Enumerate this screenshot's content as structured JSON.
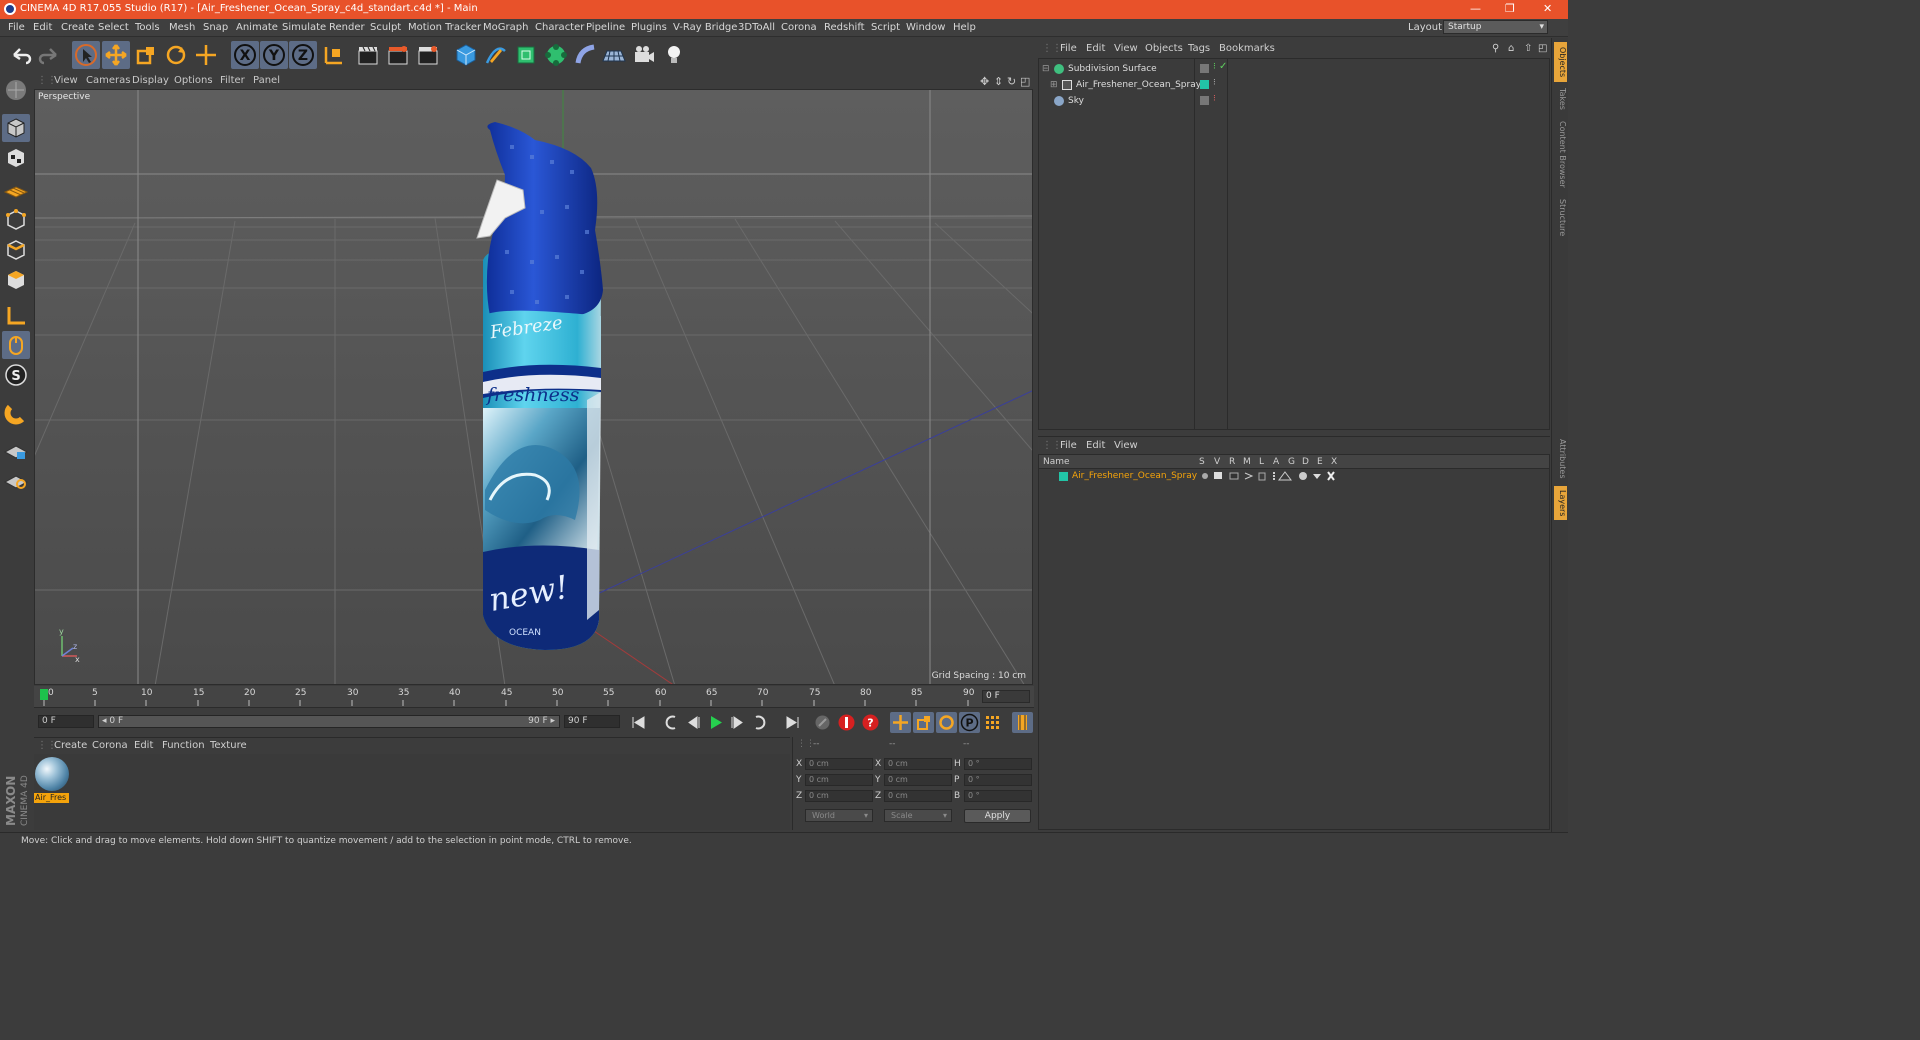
{
  "window": {
    "title": "CINEMA 4D R17.055 Studio (R17) - [Air_Freshener_Ocean_Spray_c4d_standart.c4d *] - Main",
    "minimize": "—",
    "restore": "❐",
    "close": "✕"
  },
  "menu": {
    "items": [
      "File",
      "Edit",
      "Create",
      "Select",
      "Tools",
      "Mesh",
      "Snap",
      "Animate",
      "Simulate",
      "Render",
      "Sculpt",
      "Motion Tracker",
      "MoGraph",
      "Character",
      "Pipeline",
      "Plugins",
      "V-Ray Bridge",
      "3DToAll",
      "Corona",
      "Redshift",
      "Script",
      "Window",
      "Help"
    ],
    "layout_label": "Layout:",
    "layout_value": "Startup"
  },
  "viewport": {
    "menu": [
      "View",
      "Cameras",
      "Display",
      "Options",
      "Filter",
      "Panel"
    ],
    "label": "Perspective",
    "grid_spacing": "Grid Spacing : 10 cm",
    "bottle_text": {
      "brand": "Febreze",
      "freshness": "freshness",
      "new": "new!",
      "ocean": "OCEAN"
    }
  },
  "timeline": {
    "ticks": [
      "0",
      "5",
      "10",
      "15",
      "20",
      "25",
      "30",
      "35",
      "40",
      "45",
      "50",
      "55",
      "60",
      "65",
      "70",
      "75",
      "80",
      "85",
      "90"
    ],
    "current_frame_field": "0 F",
    "start_field": "0 F",
    "range_start": "◂ 0 F",
    "range_end": "90 F ▸",
    "end_field": "90 F",
    "frame_end_display": "0 F"
  },
  "material_manager": {
    "menu": [
      "Create",
      "Corona",
      "Edit",
      "Function",
      "Texture"
    ],
    "materials": [
      {
        "name": "Air_Fres"
      }
    ]
  },
  "coordinates": {
    "header": [
      "--",
      "--",
      "--"
    ],
    "rows": [
      {
        "axis": "X",
        "pos": "0 cm",
        "axis2": "X",
        "size": "0 cm",
        "rot_label": "H",
        "rot": "0 °"
      },
      {
        "axis": "Y",
        "pos": "0 cm",
        "axis2": "Y",
        "size": "0 cm",
        "rot_label": "P",
        "rot": "0 °"
      },
      {
        "axis": "Z",
        "pos": "0 cm",
        "axis2": "Z",
        "size": "0 cm",
        "rot_label": "B",
        "rot": "0 °"
      }
    ],
    "mode_select": "World",
    "scale_select": "Scale",
    "apply_label": "Apply"
  },
  "status": {
    "text": "Move: Click and drag to move elements. Hold down SHIFT to quantize movement / add to the selection in point mode, CTRL to remove."
  },
  "brand": {
    "maxon": "MAXON",
    "cinema": "CINEMA 4D"
  },
  "object_manager": {
    "menu": [
      "File",
      "Edit",
      "View",
      "Objects",
      "Tags",
      "Bookmarks"
    ],
    "objects": [
      {
        "name": "Subdivision Surface",
        "expander": "⊟",
        "color": "#3fbf7f"
      },
      {
        "name": "Air_Freshener_Ocean_Spray",
        "expander": "⊞",
        "color": "#2a9c8e"
      },
      {
        "name": "Sky",
        "expander": "",
        "color": "#8aa6c8"
      }
    ]
  },
  "layer_manager": {
    "menu": [
      "File",
      "Edit",
      "View"
    ],
    "columns": [
      "Name",
      "S",
      "V",
      "R",
      "M",
      "L",
      "A",
      "G",
      "D",
      "E",
      "X"
    ],
    "layers": [
      {
        "name": "Air_Freshener_Ocean_Spray",
        "color": "#22c4a6"
      }
    ]
  },
  "side_tabs": [
    "Objects",
    "Takes",
    "Content Browser",
    "Structure",
    "Attributes",
    "Layers"
  ],
  "colors": {
    "titlebar": "#e8522a",
    "accent_active": "#5d6c86",
    "layer_name": "#f4a30b"
  }
}
